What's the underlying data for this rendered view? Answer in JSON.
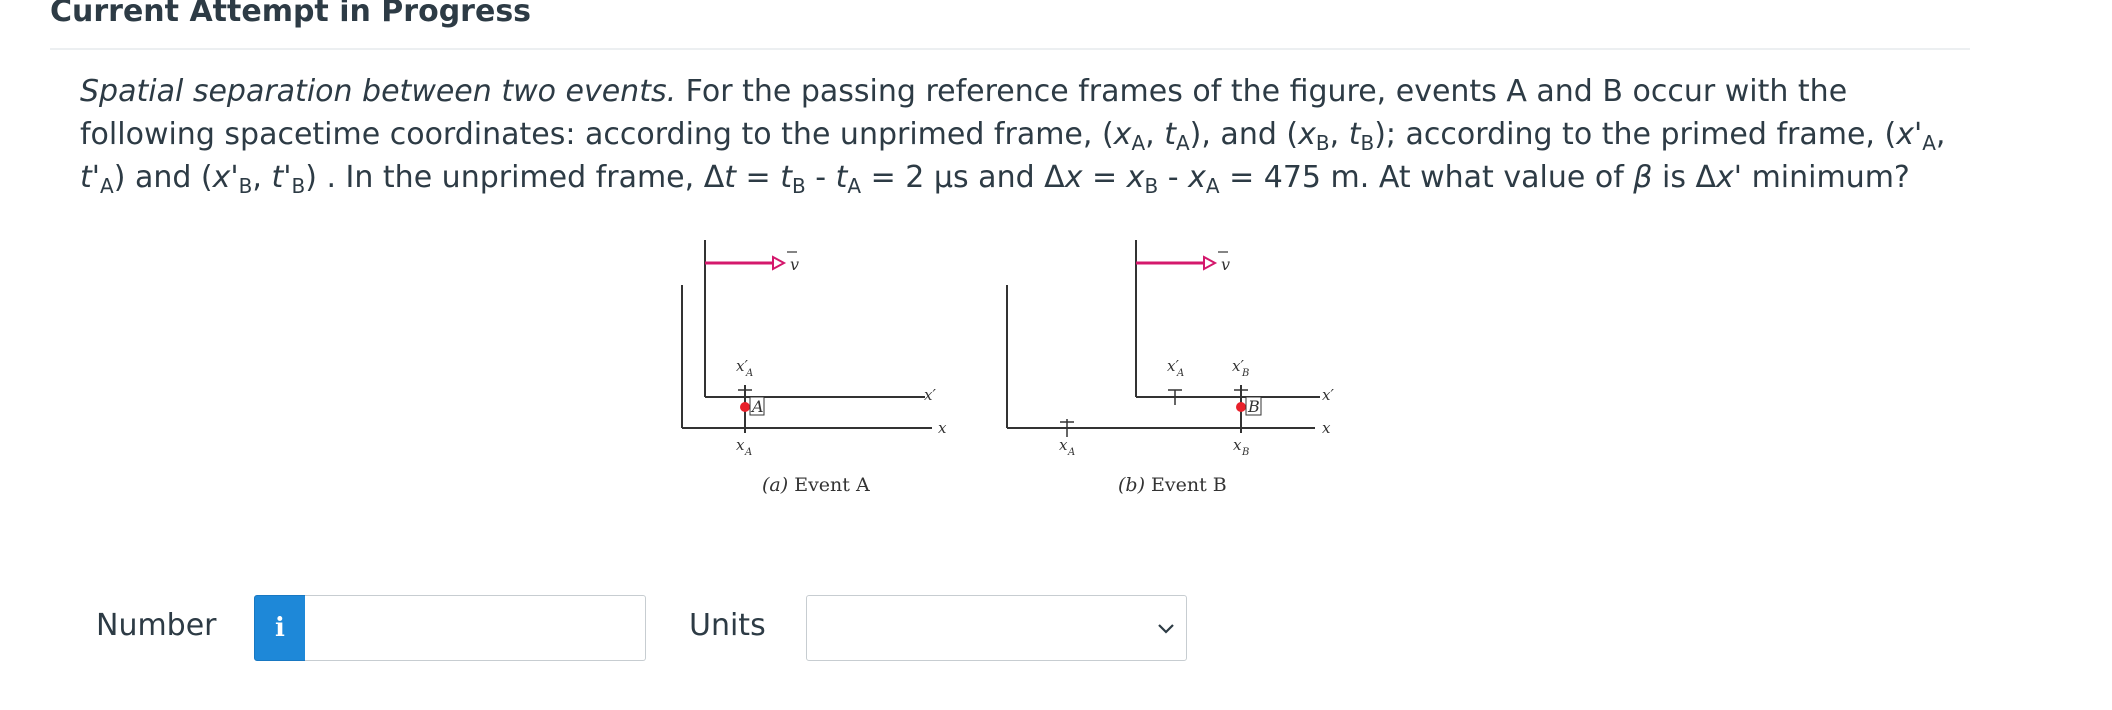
{
  "page": {
    "title": "Current Attempt in Progress"
  },
  "question": {
    "lead_italic": "Spatial separation between two events.",
    "text_1": " For the passing reference frames of the figure, events A and B occur with the following spacetime coordinates: according to the unprimed frame, (",
    "text_2": "), and (",
    "text_3": "); according to the primed frame, (",
    "text_4": ") and (",
    "text_5": ") . In the unprimed frame, Δ",
    "text_6": " = 2 μs and Δ",
    "text_7": " = 475 m. At what value of ",
    "text_8": " is Δ",
    "text_9": " minimum?"
  },
  "symbols": {
    "x": "x",
    "t": "t",
    "xp": "x'",
    "tp": "t'",
    "A": "A",
    "B": "B",
    "comma": ", ",
    "eq": " = ",
    "minus": " - ",
    "beta": "β"
  },
  "figure": {
    "panel_a": {
      "caption_letter": "(a)",
      "caption_text": " Event A",
      "label_v": "v",
      "label_xA_prime": "x′",
      "sub_A": "A",
      "label_xA": "x",
      "event_label": "A",
      "axis_x_prime": "x′",
      "axis_x": "x"
    },
    "panel_b": {
      "caption_letter": "(b)",
      "caption_text": " Event B",
      "label_v": "v",
      "label_xA_prime": "x′",
      "label_xB_prime": "x′",
      "sub_A": "A",
      "sub_B": "B",
      "label_xA": "x",
      "label_xB": "x",
      "event_label": "B",
      "axis_x_prime": "x′",
      "axis_x": "x"
    },
    "colors": {
      "arrow": "#d4186c",
      "event": "#e8202a",
      "axes": "#333333"
    }
  },
  "answer": {
    "number_label": "Number",
    "info_icon": "i",
    "number_value": "",
    "units_label": "Units",
    "units_selected": ""
  }
}
